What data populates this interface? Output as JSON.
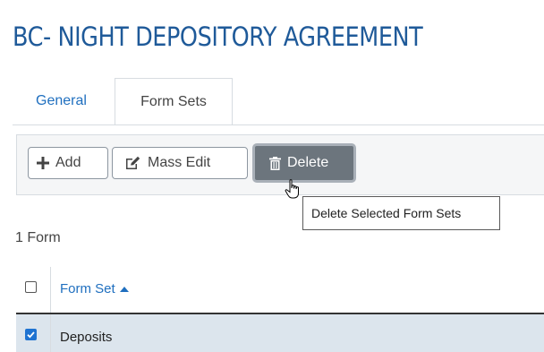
{
  "page": {
    "title": "BC- NIGHT DEPOSITORY AGREEMENT"
  },
  "tabs": [
    {
      "label": "General",
      "active": false
    },
    {
      "label": "Form Sets",
      "active": true
    }
  ],
  "toolbar": {
    "add_label": "Add",
    "mass_edit_label": "Mass Edit",
    "delete_label": "Delete",
    "icons": {
      "add": "plus-icon",
      "mass_edit": "edit-icon",
      "delete": "trash-icon"
    }
  },
  "tooltip": {
    "text": "Delete Selected Form Sets"
  },
  "grid": {
    "count_text": "1 Form",
    "column_header": "Form Set",
    "sort": "ascending",
    "header_checked": false,
    "rows": [
      {
        "label": "Deposits",
        "checked": true
      }
    ]
  },
  "colors": {
    "accent": "#1f6fbf",
    "title": "#1f5a99",
    "selected_row": "#dce5ed",
    "delete_button": "#6c757d"
  }
}
